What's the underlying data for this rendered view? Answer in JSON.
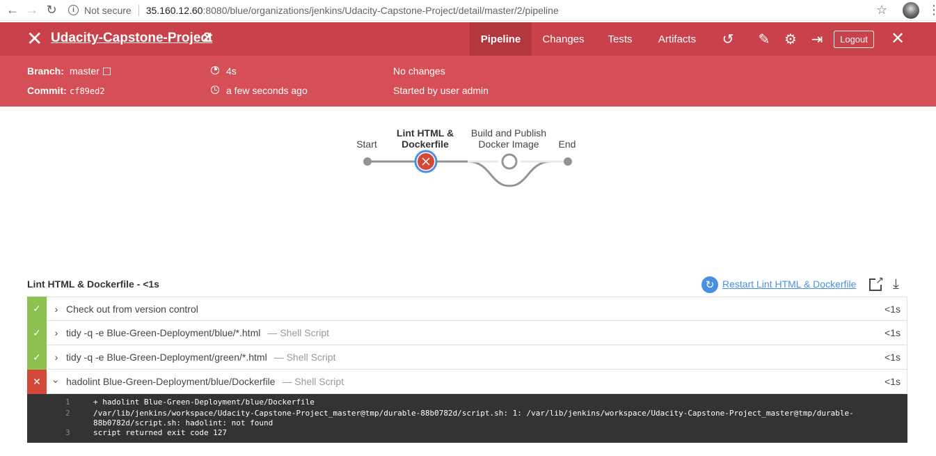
{
  "browser": {
    "security_label": "Not secure",
    "url_host": "35.160.12.60",
    "url_rest": ":8080/blue/organizations/jenkins/Udacity-Capstone-Project/detail/master/2/pipeline"
  },
  "header": {
    "project_name": "Udacity-Capstone-Project",
    "run_number": "2",
    "tabs": [
      {
        "label": "Pipeline",
        "active": true
      },
      {
        "label": "Changes",
        "active": false
      },
      {
        "label": "Tests",
        "active": false
      },
      {
        "label": "Artifacts",
        "active": false
      }
    ],
    "logout_label": "Logout"
  },
  "meta": {
    "branch_label": "Branch:",
    "branch_value": "master",
    "commit_label": "Commit:",
    "commit_value": "cf89ed2",
    "duration": "4s",
    "started_ago": "a few seconds ago",
    "changes": "No changes",
    "started_by": "Started by user admin"
  },
  "pipeline": {
    "stages": [
      {
        "label": "Start",
        "status": "node"
      },
      {
        "label_line1": "Lint HTML &",
        "label_line2": "Dockerfile",
        "status": "failed"
      },
      {
        "label_line1": "Build and Publish",
        "label_line2": "Docker Image",
        "status": "not_built"
      },
      {
        "label": "End",
        "status": "node"
      }
    ]
  },
  "stage_detail": {
    "title": "Lint HTML & Dockerfile - <1s",
    "restart_label": "Restart Lint HTML & Dockerfile",
    "steps": [
      {
        "text": "Check out from version control",
        "sub": "",
        "duration": "<1s",
        "status": "success",
        "expanded": false
      },
      {
        "text": "tidy -q -e Blue-Green-Deployment/blue/*.html",
        "sub": "— Shell Script",
        "duration": "<1s",
        "status": "success",
        "expanded": false
      },
      {
        "text": "tidy -q -e Blue-Green-Deployment/green/*.html",
        "sub": "— Shell Script",
        "duration": "<1s",
        "status": "success",
        "expanded": false
      },
      {
        "text": "hadolint Blue-Green-Deployment/blue/Dockerfile",
        "sub": "— Shell Script",
        "duration": "<1s",
        "status": "failure",
        "expanded": true
      }
    ],
    "log": [
      {
        "n": "1",
        "lines": [
          "+ hadolint Blue-Green-Deployment/blue/Dockerfile"
        ]
      },
      {
        "n": "2",
        "lines": [
          "/var/lib/jenkins/workspace/Udacity-Capstone-Project_master@tmp/durable-88b0782d/script.sh: 1: /var/lib/jenkins/workspace/Udacity-Capstone-Project_master@tmp/durable-",
          "88b0782d/script.sh: hadolint: not found"
        ]
      },
      {
        "n": "3",
        "lines": [
          "script returned exit code 127"
        ]
      }
    ]
  },
  "colors": {
    "header_bg": "#c8414b",
    "meta_bg": "#d64f57",
    "success": "#8cc04f",
    "failure": "#d24939",
    "link": "#4a90e2"
  }
}
